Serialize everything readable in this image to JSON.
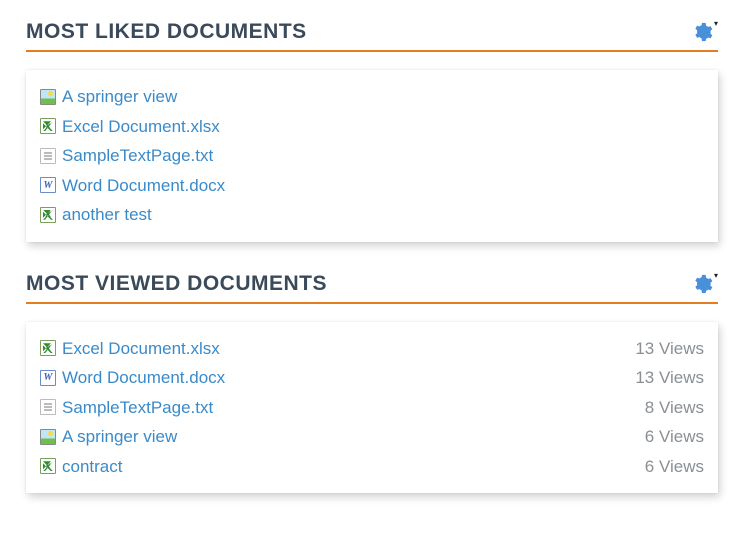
{
  "panels": [
    {
      "title": "MOST LIKED DOCUMENTS",
      "items": [
        {
          "icon": "image",
          "name": "A springer view"
        },
        {
          "icon": "excel",
          "name": "Excel Document.xlsx"
        },
        {
          "icon": "text",
          "name": "SampleTextPage.txt"
        },
        {
          "icon": "word",
          "name": "Word Document.docx"
        },
        {
          "icon": "excel",
          "name": "another test"
        }
      ]
    },
    {
      "title": "MOST VIEWED DOCUMENTS",
      "items": [
        {
          "icon": "excel",
          "name": "Excel Document.xlsx",
          "views": "13 Views"
        },
        {
          "icon": "word",
          "name": "Word Document.docx",
          "views": "13 Views"
        },
        {
          "icon": "text",
          "name": "SampleTextPage.txt",
          "views": "8 Views"
        },
        {
          "icon": "image",
          "name": "A springer view",
          "views": "6 Views"
        },
        {
          "icon": "excel",
          "name": "contract",
          "views": "6 Views"
        }
      ]
    }
  ]
}
